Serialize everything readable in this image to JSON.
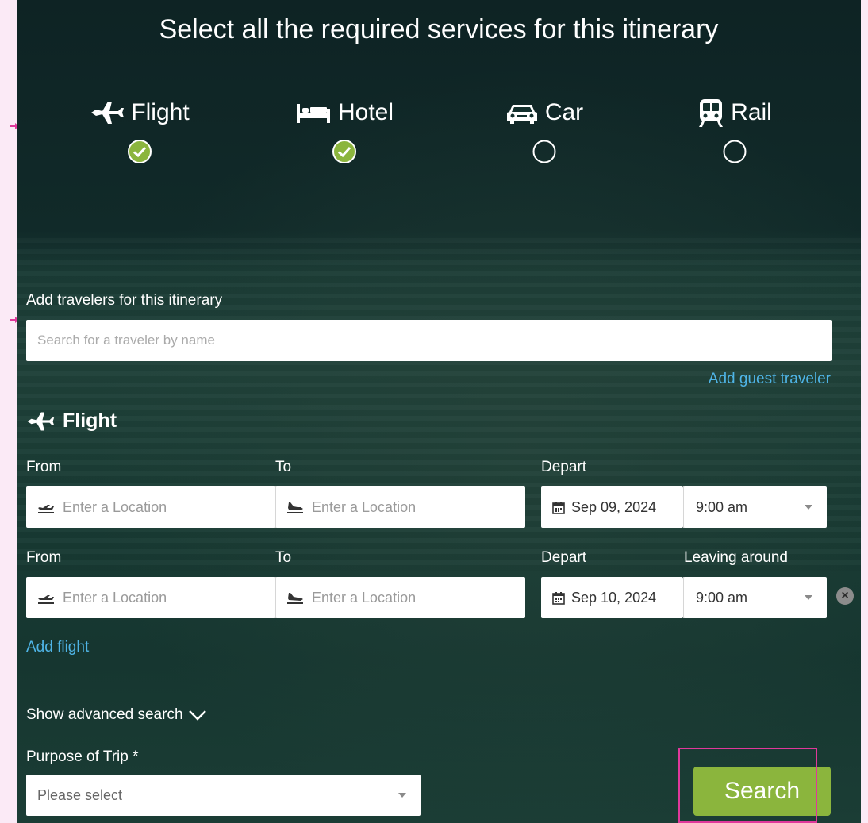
{
  "title": "Select all the required services for this itinerary",
  "services": [
    {
      "label": "Flight",
      "icon": "airplane-icon",
      "selected": true
    },
    {
      "label": "Hotel",
      "icon": "bed-icon",
      "selected": true
    },
    {
      "label": "Car",
      "icon": "car-icon",
      "selected": false
    },
    {
      "label": "Rail",
      "icon": "train-icon",
      "selected": false
    }
  ],
  "travelers": {
    "label": "Add travelers for this itinerary",
    "placeholder": "Search for a traveler by name",
    "add_guest": "Add guest traveler"
  },
  "flight": {
    "heading": "Flight",
    "legs": [
      {
        "from_label": "From",
        "to_label": "To",
        "depart_label": "Depart",
        "time_label": "",
        "from_placeholder": "Enter a Location",
        "to_placeholder": "Enter a Location",
        "date": "Sep 09, 2024",
        "time": "9:00 am"
      },
      {
        "from_label": "From",
        "to_label": "To",
        "depart_label": "Depart",
        "time_label": "Leaving around",
        "from_placeholder": "Enter a Location",
        "to_placeholder": "Enter a Location",
        "date": "Sep 10, 2024",
        "time": "9:00 am"
      }
    ],
    "add_flight": "Add flight"
  },
  "advanced": "Show advanced search",
  "purpose": {
    "label": "Purpose of Trip *",
    "placeholder": "Please select"
  },
  "search_button": "Search",
  "colors": {
    "accent_link": "#4fb4e6",
    "search_green": "#8bb53d",
    "check_green": "#8bb53d",
    "highlight": "#e0389b"
  }
}
